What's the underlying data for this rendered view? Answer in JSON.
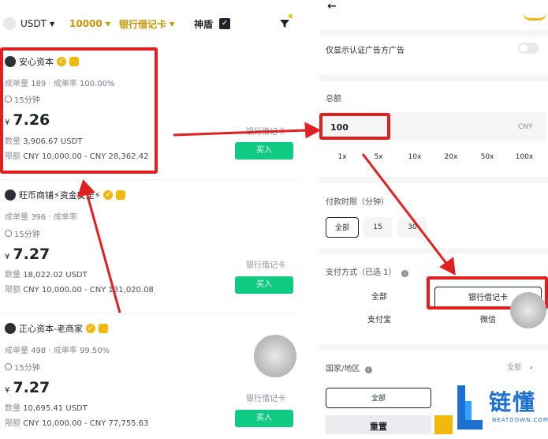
{
  "left": {
    "toolbar": {
      "coin": "USDT",
      "amount": "10000",
      "payment": "银行借记卡",
      "shield": "神盾"
    },
    "ads": [
      {
        "name": "安心资本",
        "orders_label": "成单量",
        "orders": "189",
        "rate_label": "· 成单率",
        "rate": "100.00%",
        "time": "15分钟",
        "currency": "¥",
        "price": "7.26",
        "qty_label": "数量",
        "qty": "3,906.67 USDT",
        "limit_label": "限额",
        "limit": "CNY 10,000.00 - CNY 28,362.42",
        "pay": "银行借记卡",
        "buy": "买入"
      },
      {
        "name": "旺币商铺⚡资金安全⚡",
        "orders_label": "成单量",
        "orders": "396",
        "rate_label": "· 成单率",
        "rate": "",
        "time": "15分钟",
        "currency": "¥",
        "price": "7.27",
        "qty_label": "数量",
        "qty": "18,022.02 USDT",
        "limit_label": "限额",
        "limit": "CNY 10,000.00 - CNY 131,020.08",
        "pay": "银行借记卡",
        "buy": "买入"
      },
      {
        "name": "正心资本-老商家",
        "orders_label": "成单量",
        "orders": "498",
        "rate_label": "· 成单率",
        "rate": "99.50%",
        "time": "15分钟",
        "currency": "¥",
        "price": "7.27",
        "qty_label": "数量",
        "qty": "10,695.41 USDT",
        "limit_label": "限额",
        "limit": "CNY 10,000.00 - CNY 77,755.63",
        "pay": "银行借记卡",
        "buy": "买入"
      }
    ]
  },
  "right": {
    "back": "←",
    "verified_only": "仅显示认证广告方广告",
    "amount_label": "总额",
    "amount_value": "100",
    "amount_currency": "CNY",
    "multipliers": [
      "1x",
      "5x",
      "10x",
      "20x",
      "50x",
      "100x"
    ],
    "time_label": "付款时限（分钟）",
    "time_options": [
      "全部",
      "15",
      "30"
    ],
    "pay_label": "支付方式（已选 1）",
    "pay_options": [
      "全部",
      "银行借记卡",
      "支付宝",
      "微信"
    ],
    "region_label": "国家/地区",
    "region_value": "全部",
    "all_button": "全部",
    "reset_button": "重置"
  },
  "watermark": {
    "brand": "链懂",
    "site": "NEATDOWN.COM"
  },
  "colors": {
    "accent": "#f0b90b",
    "buy": "#0ecb81",
    "highlight": "#e02020"
  }
}
